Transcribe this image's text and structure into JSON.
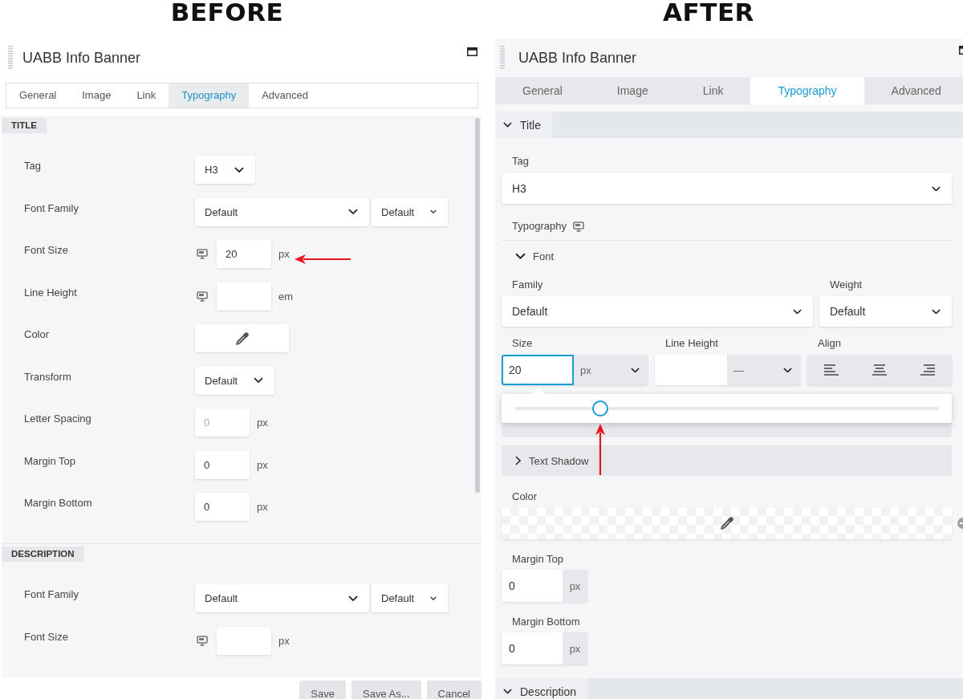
{
  "before": {
    "caption": "BEFORE",
    "panel": {
      "title": "UABB Info Banner",
      "tabs": [
        {
          "label": "General",
          "selected": false
        },
        {
          "label": "Image",
          "selected": false
        },
        {
          "label": "Link",
          "selected": false
        },
        {
          "label": "Typography",
          "selected": true
        },
        {
          "label": "Advanced",
          "selected": false
        }
      ],
      "sections": [
        {
          "heading": "TITLE",
          "fields": [
            {
              "kind": "select",
              "label": "Tag",
              "values": [
                "H3"
              ]
            },
            {
              "kind": "select",
              "label": "Font Family",
              "values": [
                "Default",
                "Default"
              ]
            },
            {
              "kind": "number",
              "label": "Font Size",
              "responsive": true,
              "value": "20",
              "unit": "px"
            },
            {
              "kind": "number",
              "label": "Line Height",
              "responsive": true,
              "unit": "em"
            },
            {
              "kind": "color",
              "label": "Color"
            },
            {
              "kind": "select",
              "label": "Transform",
              "values": [
                "Default"
              ]
            },
            {
              "kind": "number",
              "label": "Letter Spacing",
              "responsive": false,
              "placeholder": "0",
              "unit": "px"
            },
            {
              "kind": "number",
              "label": "Margin Top",
              "responsive": false,
              "value": "0",
              "unit": "px"
            },
            {
              "kind": "number",
              "label": "Margin Bottom",
              "responsive": false,
              "value": "0",
              "unit": "px"
            }
          ]
        },
        {
          "heading": "DESCRIPTION",
          "fields": [
            {
              "kind": "select",
              "label": "Font Family",
              "values": [
                "Default",
                "Default"
              ]
            },
            {
              "kind": "number",
              "label": "Font Size",
              "responsive": true,
              "unit": "px"
            }
          ]
        }
      ],
      "buttons": [
        "Save",
        "Save As...",
        "Cancel"
      ]
    }
  },
  "after": {
    "caption": "AFTER",
    "panel": {
      "title": "UABB Info Banner",
      "tabs": [
        {
          "label": "General",
          "selected": false
        },
        {
          "label": "Image",
          "selected": false
        },
        {
          "label": "Link",
          "selected": false
        },
        {
          "label": "Typography",
          "selected": true
        },
        {
          "label": "Advanced",
          "selected": false
        }
      ],
      "sections": [
        {
          "heading": "Title",
          "expanded": true,
          "tag": {
            "label": "Tag",
            "value": "H3"
          },
          "typography": {
            "label": "Typography",
            "responsive": true,
            "font": {
              "heading": "Font",
              "expanded": true,
              "family": {
                "label": "Family",
                "value": "Default"
              },
              "weight": {
                "label": "Weight",
                "value": "Default"
              },
              "size": {
                "label": "Size",
                "value": "20",
                "unit": "px",
                "focused": true
              },
              "line_height": {
                "label": "Line Height",
                "unit": "—"
              },
              "align": {
                "label": "Align"
              },
              "slider": {
                "level": 0.2
              }
            },
            "groups": [
              {
                "heading": "Text Shadow",
                "expanded": false
              }
            ]
          },
          "color": {
            "label": "Color"
          },
          "margin_top": {
            "label": "Margin Top",
            "value": "0",
            "unit": "px"
          },
          "margin_bottom": {
            "label": "Margin Bottom",
            "value": "0",
            "unit": "px"
          }
        },
        {
          "heading": "Description",
          "expanded": true
        }
      ]
    }
  }
}
